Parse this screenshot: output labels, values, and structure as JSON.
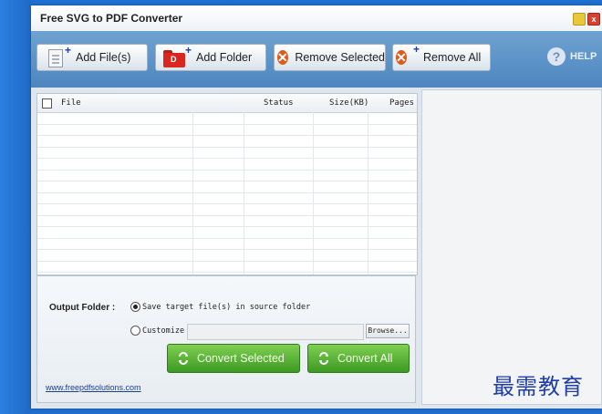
{
  "window": {
    "title": "Free SVG to PDF Converter",
    "close_glyph": "x"
  },
  "toolbar": {
    "add_files": "Add File(s)",
    "add_folder": "Add Folder",
    "remove_selected": "Remove Selected",
    "remove_all": "Remove All",
    "help": "HELP"
  },
  "file_list": {
    "columns": [
      "File",
      "Status",
      "Size(KB)",
      "Pages"
    ],
    "rows": []
  },
  "output": {
    "label": "Output Folder :",
    "option_source": "Save target file(s) in source folder",
    "option_customize": "Customize",
    "custom_path": "",
    "browse": "Browse...",
    "selected_option": "source"
  },
  "actions": {
    "convert_selected": "Convert Selected",
    "convert_all": "Convert All"
  },
  "footer": {
    "website": "www.freepdfsolutions.com"
  },
  "watermark": "最需教育",
  "colors": {
    "toolbar": "#5b93c8",
    "convert_green": "#4aa72c",
    "remove_orange": "#e05a18",
    "folder_red": "#d9271f"
  }
}
